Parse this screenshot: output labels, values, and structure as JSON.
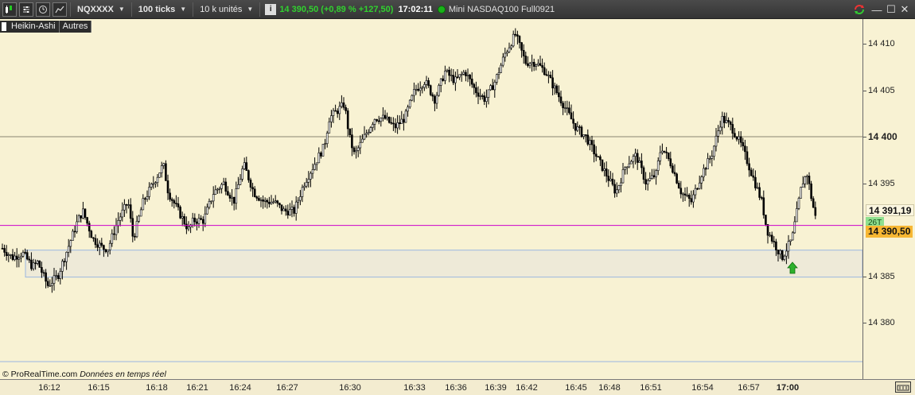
{
  "toolbar": {
    "symbol": "NQXXXX",
    "period": "100 ticks",
    "units": "10 k unités",
    "price_info": "14 390,50 (+0,89 % +127,50)",
    "time": "17:02:11",
    "instrument": "Mini NASDAQ100 Full0921"
  },
  "legend": {
    "type": "Heikin-Ashi",
    "other": "Autres"
  },
  "credit": {
    "brand": "© ProRealTime.com",
    "status": "Données en temps réel"
  },
  "badges": {
    "last": "14 391,19",
    "ticks": "26T",
    "price": "14 390,50"
  },
  "colors": {
    "background": "#f8f2d3",
    "price_line": "#cc00cc",
    "zone_fill": "#eeead8",
    "zone_border": "#9ab6e0",
    "up_arrow": "#2db22d",
    "price_badge": "#f7b733",
    "toolbar_green": "#31d12f"
  },
  "icons": [
    "chart-type-icon",
    "settings-icon",
    "clock-icon",
    "indicators-icon",
    "info-icon",
    "connection-icon",
    "refresh-icon",
    "minimize-icon",
    "maximize-icon",
    "close-icon"
  ],
  "chart_data": {
    "type": "candlestick",
    "style": "Heikin-Ashi",
    "y_ticks": [
      "14 410",
      "14 405",
      "14 400",
      "14 395",
      "14 385",
      "14 380"
    ],
    "y_values": [
      14410,
      14405,
      14400,
      14395,
      14385,
      14380
    ],
    "y_bold": "14 400",
    "ylim": [
      14377.4,
      14412
    ],
    "x_ticks": [
      "16:12",
      "16:15",
      "16:18",
      "16:21",
      "16:24",
      "16:27",
      "16:30",
      "16:33",
      "16:36",
      "16:39",
      "16:42",
      "16:45",
      "16:48",
      "16:51",
      "16:54",
      "16:57",
      "17:00"
    ],
    "x_bold": "17:00",
    "current_price": 14390.5,
    "last_value": 14391.19,
    "horizontal_level": 14400,
    "zone": [
      14384.9,
      14387.8
    ],
    "signal": "up-arrow",
    "path": [
      [
        0,
        14388
      ],
      [
        2,
        14387
      ],
      [
        4,
        14387.5
      ],
      [
        6,
        14386
      ],
      [
        7,
        14386.5
      ],
      [
        9,
        14384
      ],
      [
        11,
        14385
      ],
      [
        13,
        14388
      ],
      [
        15,
        14391
      ],
      [
        16,
        14392
      ],
      [
        18,
        14389
      ],
      [
        20,
        14388
      ],
      [
        21,
        14388
      ],
      [
        23,
        14391
      ],
      [
        25,
        14393
      ],
      [
        26,
        14389
      ],
      [
        28,
        14393
      ],
      [
        30,
        14395
      ],
      [
        32,
        14397
      ],
      [
        33,
        14394
      ],
      [
        35,
        14392
      ],
      [
        37,
        14390
      ],
      [
        38,
        14391
      ],
      [
        40,
        14391
      ],
      [
        42,
        14394
      ],
      [
        44,
        14395
      ],
      [
        46,
        14393
      ],
      [
        47,
        14395
      ],
      [
        48,
        14397
      ],
      [
        50,
        14394
      ],
      [
        52,
        14393
      ],
      [
        54,
        14393
      ],
      [
        56,
        14392
      ],
      [
        58,
        14392
      ],
      [
        60,
        14395
      ],
      [
        62,
        14397
      ],
      [
        64,
        14399
      ],
      [
        65,
        14402
      ],
      [
        67,
        14403
      ],
      [
        68,
        14403.5
      ],
      [
        69,
        14400
      ],
      [
        70,
        14398
      ],
      [
        72,
        14400
      ],
      [
        74,
        14402
      ],
      [
        76,
        14402
      ],
      [
        78,
        14401
      ],
      [
        80,
        14402
      ],
      [
        82,
        14405
      ],
      [
        84,
        14406
      ],
      [
        86,
        14404
      ],
      [
        88,
        14407
      ],
      [
        90,
        14406
      ],
      [
        92,
        14407
      ],
      [
        94,
        14405
      ],
      [
        96,
        14404
      ],
      [
        98,
        14406
      ],
      [
        100,
        14409
      ],
      [
        102,
        14411
      ],
      [
        104,
        14408
      ],
      [
        106,
        14408
      ],
      [
        108,
        14407
      ],
      [
        110,
        14405
      ],
      [
        112,
        14403
      ],
      [
        114,
        14401
      ],
      [
        116,
        14400
      ],
      [
        118,
        14398
      ],
      [
        120,
        14396
      ],
      [
        122,
        14394
      ],
      [
        124,
        14397
      ],
      [
        126,
        14398
      ],
      [
        128,
        14395
      ],
      [
        130,
        14396
      ],
      [
        131,
        14399
      ],
      [
        133,
        14397
      ],
      [
        135,
        14394
      ],
      [
        137,
        14393
      ],
      [
        139,
        14396
      ],
      [
        141,
        14398
      ],
      [
        143,
        14402
      ],
      [
        145,
        14401
      ],
      [
        147,
        14399
      ],
      [
        149,
        14396
      ],
      [
        151,
        14393
      ],
      [
        152,
        14390
      ],
      [
        154,
        14388
      ],
      [
        155,
        14387
      ],
      [
        157,
        14389
      ],
      [
        158,
        14392
      ],
      [
        159,
        14395
      ],
      [
        160,
        14396
      ],
      [
        161,
        14393
      ],
      [
        162,
        14390.5
      ]
    ]
  }
}
